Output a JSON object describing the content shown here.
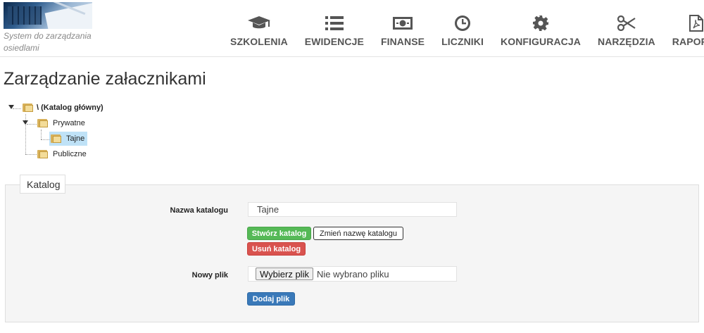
{
  "app": {
    "tagline": "System do zarządzania osiedlami"
  },
  "nav": {
    "items": [
      {
        "label": "SZKOLENIA",
        "icon": "graduation-cap-icon"
      },
      {
        "label": "EWIDENCJE",
        "icon": "list-icon"
      },
      {
        "label": "FINANSE",
        "icon": "money-icon"
      },
      {
        "label": "LICZNIKI",
        "icon": "clock-icon"
      },
      {
        "label": "KONFIGURACJA",
        "icon": "gear-icon"
      },
      {
        "label": "NARZĘDZIA",
        "icon": "scissors-icon"
      },
      {
        "label": "RAPORTY",
        "icon": "pdf-file-icon"
      }
    ]
  },
  "page": {
    "title": "Zarządzanie załacznikami"
  },
  "tree": {
    "root": "\\ (Katalog główny)",
    "private": "Prywatne",
    "secret": "Tajne",
    "public": "Publiczne",
    "selected": "Tajne"
  },
  "catalog_form": {
    "legend": "Katalog",
    "name_label": "Nazwa katalogu",
    "name_value": "Tajne",
    "create_button": "Stwórz katalog",
    "rename_button": "Zmień nazwę katalogu",
    "delete_button": "Usuń katalog",
    "file_label": "Nowy plik",
    "file_choose_button": "Wybierz plik",
    "file_status": "Nie wybrano pliku",
    "add_file_button": "Dodaj plik"
  },
  "colors": {
    "green": "#55b956",
    "red": "#d9534f",
    "blue": "#3a79b9",
    "selected": "#bfe2f7"
  }
}
